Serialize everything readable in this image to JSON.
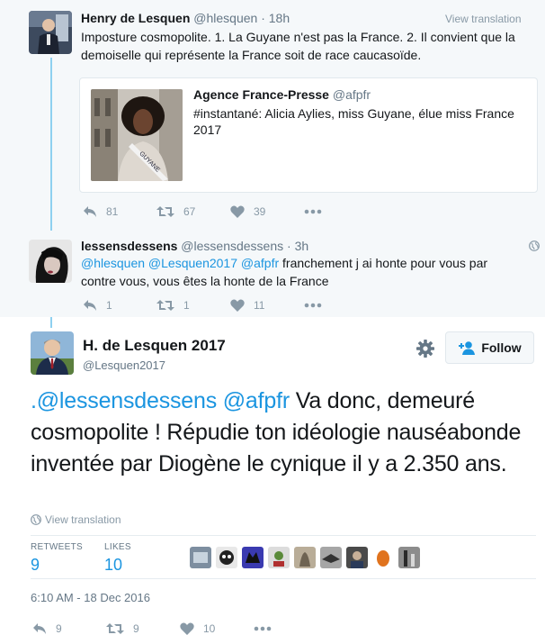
{
  "tweet1": {
    "fullname": "Henry de Lesquen",
    "handle": "@hlesquen",
    "time": "18h",
    "view_translation": "View translation",
    "text": "Imposture cosmopolite. 1. La Guyane n'est pas la France. 2. Il convient que la demoiselle qui représente la France soit de race caucasoïde.",
    "quote": {
      "fullname": "Agence France-Presse",
      "handle": "@afpfr",
      "text": "#instantané: Alicia Aylies, miss Guyane, élue miss France 2017",
      "image_sash_text": "GUYANE"
    },
    "actions": {
      "replies": "81",
      "retweets": "67",
      "likes": "39"
    }
  },
  "tweet2": {
    "fullname": "lessensdessens",
    "handle": "@lessensdessens",
    "time": "3h",
    "mentions": "@hlesquen @Lesquen2017 @afpfr",
    "text": " franchement j ai honte pour vous par contre vous, vous êtes la honte de la France",
    "actions": {
      "replies": "1",
      "retweets": "1",
      "likes": "11"
    }
  },
  "main": {
    "fullname": "H. de Lesquen 2017",
    "handle": "@Lesquen2017",
    "follow_label": "Follow",
    "prefix": ".",
    "mentions": "@lessensdessens @afpfr",
    "text": " Va donc, demeuré cosmopolite ! Répudie ton idéologie nauséabonde inventée par Diogène le cynique il y a 2.350 ans.",
    "view_translation": "View translation",
    "retweets_label": "RETWEETS",
    "retweets_count": "9",
    "likes_label": "LIKES",
    "likes_count": "10",
    "timestamp": "6:10 AM - 18 Dec 2016",
    "actions": {
      "replies": "9",
      "retweets": "9",
      "likes": "10"
    }
  },
  "colors": {
    "link": "#1b95e0",
    "icon": "#8899a6",
    "thread_line": "#8ed0f0",
    "parent_bg": "#f5f8fa"
  }
}
